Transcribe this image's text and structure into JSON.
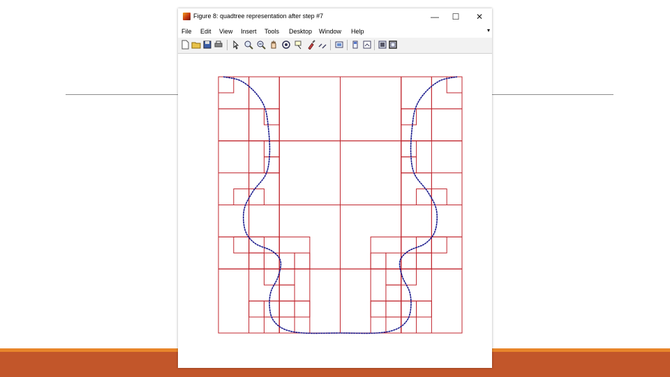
{
  "window": {
    "title": "Figure 8: quadtree representation after step #7",
    "controls": {
      "minimize": "—",
      "maximize": "☐",
      "close": "✕"
    }
  },
  "menu": [
    "File",
    "Edit",
    "View",
    "Insert",
    "Tools",
    "Desktop",
    "Window",
    "Help"
  ],
  "menu_overflow": "▾",
  "toolbar": [
    "new-figure-icon",
    "open-file-icon",
    "save-icon",
    "print-icon",
    "edit-plot-icon",
    "zoom-in-icon",
    "zoom-out-icon",
    "pan-icon",
    "rotate-3d-icon",
    "data-cursor-icon",
    "brush-icon",
    "link-plot-icon",
    "insert-colorbar-icon",
    "insert-legend-icon",
    "hide-plot-tools-icon",
    "show-plot-tools-icon"
  ],
  "colors": {
    "quadtree": "#c0262e",
    "curve": "#1a1a8c",
    "slide_bar": "#c2562a",
    "slide_bar_accent": "#e8852a"
  },
  "chart_data": {
    "type": "quadtree",
    "xlim": [
      0,
      1
    ],
    "ylim": [
      0,
      1
    ],
    "cells": [
      [
        0,
        0,
        0.25,
        0.25
      ],
      [
        0.25,
        0,
        0.25,
        0.25
      ],
      [
        0.5,
        0,
        0.25,
        0.25
      ],
      [
        0.75,
        0,
        0.25,
        0.25
      ],
      [
        0,
        0.25,
        0.25,
        0.25
      ],
      [
        0.25,
        0.25,
        0.25,
        0.25
      ],
      [
        0.5,
        0.25,
        0.25,
        0.25
      ],
      [
        0.75,
        0.25,
        0.25,
        0.25
      ],
      [
        0,
        0.5,
        0.25,
        0.25
      ],
      [
        0.25,
        0.5,
        0.25,
        0.25
      ],
      [
        0.5,
        0.5,
        0.25,
        0.25
      ],
      [
        0.75,
        0.5,
        0.25,
        0.25
      ],
      [
        0,
        0.75,
        0.25,
        0.25
      ],
      [
        0.25,
        0.75,
        0.25,
        0.25
      ],
      [
        0.5,
        0.75,
        0.25,
        0.25
      ],
      [
        0.75,
        0.75,
        0.25,
        0.25
      ],
      [
        0,
        0,
        0.125,
        0.125
      ],
      [
        0.125,
        0,
        0.125,
        0.125
      ],
      [
        0,
        0.125,
        0.125,
        0.125
      ],
      [
        0.125,
        0.125,
        0.125,
        0.125
      ],
      [
        0.75,
        0,
        0.125,
        0.125
      ],
      [
        0.875,
        0,
        0.125,
        0.125
      ],
      [
        0.75,
        0.125,
        0.125,
        0.125
      ],
      [
        0.875,
        0.125,
        0.125,
        0.125
      ],
      [
        0.125,
        0.25,
        0.125,
        0.125
      ],
      [
        0.125,
        0.375,
        0.125,
        0.125
      ],
      [
        0.75,
        0.25,
        0.125,
        0.125
      ],
      [
        0.75,
        0.375,
        0.125,
        0.125
      ],
      [
        0,
        0.375,
        0.125,
        0.125
      ],
      [
        0.875,
        0.375,
        0.125,
        0.125
      ],
      [
        0,
        0.5,
        0.125,
        0.125
      ],
      [
        0.125,
        0.5,
        0.125,
        0.125
      ],
      [
        0.75,
        0.5,
        0.125,
        0.125
      ],
      [
        0.875,
        0.5,
        0.125,
        0.125
      ],
      [
        0,
        0.625,
        0.125,
        0.125
      ],
      [
        0.125,
        0.625,
        0.125,
        0.125
      ],
      [
        0.75,
        0.625,
        0.125,
        0.125
      ],
      [
        0.875,
        0.625,
        0.125,
        0.125
      ],
      [
        0.25,
        0.625,
        0.125,
        0.125
      ],
      [
        0.625,
        0.625,
        0.125,
        0.125
      ],
      [
        0.125,
        0.75,
        0.125,
        0.125
      ],
      [
        0.25,
        0.75,
        0.125,
        0.125
      ],
      [
        0.625,
        0.75,
        0.125,
        0.125
      ],
      [
        0.75,
        0.75,
        0.125,
        0.125
      ],
      [
        0.125,
        0.875,
        0.125,
        0.125
      ],
      [
        0.25,
        0.875,
        0.125,
        0.125
      ],
      [
        0.625,
        0.875,
        0.125,
        0.125
      ],
      [
        0.75,
        0.875,
        0.125,
        0.125
      ],
      [
        0,
        0,
        0.0625,
        0.0625
      ],
      [
        0.9375,
        0,
        0.0625,
        0.0625
      ],
      [
        0.1875,
        0.125,
        0.0625,
        0.0625
      ],
      [
        0.75,
        0.125,
        0.0625,
        0.0625
      ],
      [
        0.1875,
        0.25,
        0.0625,
        0.0625
      ],
      [
        0.1875,
        0.3125,
        0.0625,
        0.0625
      ],
      [
        0.75,
        0.25,
        0.0625,
        0.0625
      ],
      [
        0.75,
        0.3125,
        0.0625,
        0.0625
      ],
      [
        0.0625,
        0.4375,
        0.0625,
        0.0625
      ],
      [
        0.125,
        0.4375,
        0.0625,
        0.0625
      ],
      [
        0.8125,
        0.4375,
        0.0625,
        0.0625
      ],
      [
        0.875,
        0.4375,
        0.0625,
        0.0625
      ],
      [
        0.0625,
        0.625,
        0.0625,
        0.0625
      ],
      [
        0.125,
        0.625,
        0.0625,
        0.0625
      ],
      [
        0.8125,
        0.625,
        0.0625,
        0.0625
      ],
      [
        0.875,
        0.625,
        0.0625,
        0.0625
      ],
      [
        0.125,
        0.6875,
        0.0625,
        0.0625
      ],
      [
        0.1875,
        0.6875,
        0.0625,
        0.0625
      ],
      [
        0.25,
        0.6875,
        0.0625,
        0.0625
      ],
      [
        0.3125,
        0.6875,
        0.0625,
        0.0625
      ],
      [
        0.625,
        0.6875,
        0.0625,
        0.0625
      ],
      [
        0.6875,
        0.6875,
        0.0625,
        0.0625
      ],
      [
        0.75,
        0.6875,
        0.0625,
        0.0625
      ],
      [
        0.8125,
        0.6875,
        0.0625,
        0.0625
      ],
      [
        0.1875,
        0.75,
        0.0625,
        0.0625
      ],
      [
        0.25,
        0.75,
        0.0625,
        0.0625
      ],
      [
        0.6875,
        0.75,
        0.0625,
        0.0625
      ],
      [
        0.75,
        0.75,
        0.0625,
        0.0625
      ],
      [
        0.25,
        0.8125,
        0.0625,
        0.0625
      ],
      [
        0.6875,
        0.8125,
        0.0625,
        0.0625
      ],
      [
        0.125,
        0.875,
        0.0625,
        0.0625
      ],
      [
        0.1875,
        0.875,
        0.0625,
        0.0625
      ],
      [
        0.25,
        0.875,
        0.0625,
        0.0625
      ],
      [
        0.3125,
        0.875,
        0.0625,
        0.0625
      ],
      [
        0.625,
        0.875,
        0.0625,
        0.0625
      ],
      [
        0.6875,
        0.875,
        0.0625,
        0.0625
      ],
      [
        0.75,
        0.875,
        0.0625,
        0.0625
      ],
      [
        0.8125,
        0.875,
        0.0625,
        0.0625
      ],
      [
        0.1875,
        0.9375,
        0.0625,
        0.0625
      ],
      [
        0.25,
        0.9375,
        0.0625,
        0.0625
      ],
      [
        0.6875,
        0.9375,
        0.0625,
        0.0625
      ],
      [
        0.75,
        0.9375,
        0.0625,
        0.0625
      ]
    ],
    "curve": [
      [
        0.02,
        0.0
      ],
      [
        0.09,
        0.015
      ],
      [
        0.15,
        0.06
      ],
      [
        0.19,
        0.12
      ],
      [
        0.205,
        0.2
      ],
      [
        0.21,
        0.3
      ],
      [
        0.195,
        0.38
      ],
      [
        0.14,
        0.45
      ],
      [
        0.105,
        0.52
      ],
      [
        0.11,
        0.6
      ],
      [
        0.15,
        0.65
      ],
      [
        0.22,
        0.68
      ],
      [
        0.255,
        0.72
      ],
      [
        0.245,
        0.78
      ],
      [
        0.215,
        0.84
      ],
      [
        0.21,
        0.9
      ],
      [
        0.225,
        0.95
      ],
      [
        0.27,
        0.985
      ],
      [
        0.35,
        1.0
      ],
      [
        0.5,
        1.0
      ],
      [
        0.65,
        1.0
      ],
      [
        0.73,
        0.985
      ],
      [
        0.775,
        0.95
      ],
      [
        0.79,
        0.9
      ],
      [
        0.785,
        0.84
      ],
      [
        0.755,
        0.78
      ],
      [
        0.745,
        0.72
      ],
      [
        0.78,
        0.68
      ],
      [
        0.85,
        0.65
      ],
      [
        0.89,
        0.6
      ],
      [
        0.895,
        0.52
      ],
      [
        0.86,
        0.45
      ],
      [
        0.805,
        0.38
      ],
      [
        0.79,
        0.3
      ],
      [
        0.795,
        0.2
      ],
      [
        0.81,
        0.12
      ],
      [
        0.85,
        0.06
      ],
      [
        0.91,
        0.015
      ],
      [
        0.98,
        0.0
      ]
    ]
  }
}
